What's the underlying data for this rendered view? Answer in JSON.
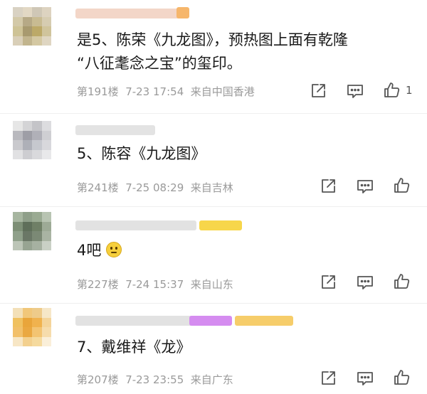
{
  "comments": [
    {
      "text_line1": "是5、陈荣《九龙图》，预热图上面有乾隆",
      "text_line2": "“八征耄念之宝”的玺印。",
      "floor": "第191楼",
      "date": "7-23",
      "time": "17:54",
      "location": "来自中国香港",
      "like_count": "1"
    },
    {
      "text_line1": "5、陈容《九龙图》",
      "floor": "第241楼",
      "date": "7-25",
      "time": "08:29",
      "location": "来自吉林"
    },
    {
      "text_line1": "4吧",
      "floor": "第227楼",
      "date": "7-24",
      "time": "15:37",
      "location": "来自山东"
    },
    {
      "text_line1": "7、戴维祥《龙》",
      "floor": "第207楼",
      "date": "7-23",
      "time": "23:55",
      "location": "来自广东"
    }
  ],
  "colors": {
    "meta_text": "#9a9a9a",
    "icon_stroke": "#555555",
    "badge_yellow": "#f7d64a",
    "badge_purple": "#d58cf0",
    "badge_orange": "#f6b66b"
  },
  "icons": [
    "share-icon",
    "comment-icon",
    "like-icon",
    "thinking-emoji"
  ]
}
